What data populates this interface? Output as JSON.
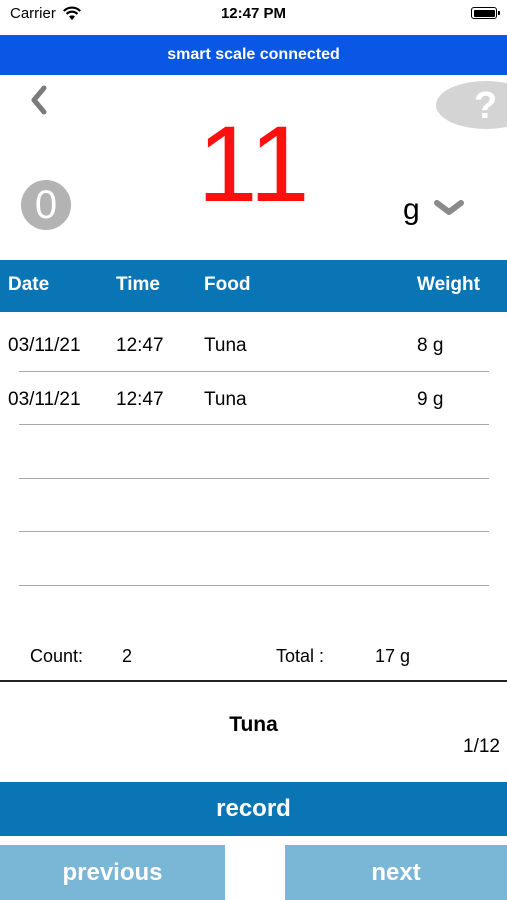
{
  "status_bar": {
    "carrier": "Carrier",
    "time": "12:47 PM"
  },
  "banner": {
    "text": "smart scale connected"
  },
  "scale": {
    "reading": "11",
    "zero_label": "0",
    "unit": "g",
    "reading_color": "#ff1010"
  },
  "icons": {
    "back": "chevron-left-icon",
    "help": "question-mark-icon",
    "unit_dropdown": "chevron-down-icon",
    "wifi": "wifi-icon",
    "battery": "battery-icon"
  },
  "table": {
    "columns": [
      "Date",
      "Time",
      "Food",
      "Weight"
    ],
    "rows": [
      {
        "date": "03/11/21",
        "time": "12:47",
        "food": "Tuna",
        "weight": "8 g"
      },
      {
        "date": "03/11/21",
        "time": "12:47",
        "food": "Tuna",
        "weight": "9 g"
      }
    ]
  },
  "summary": {
    "count_label": "Count:",
    "count_value": "2",
    "total_label": "Total :",
    "total_value": "17 g"
  },
  "current_food": {
    "name": "Tuna",
    "page": "1/12"
  },
  "actions": {
    "record": "record",
    "previous": "previous",
    "next": "next"
  },
  "colors": {
    "banner": "#0a57e6",
    "table_header": "#0a75b5",
    "record_button": "#0a75b5",
    "nav_buttons": "#7ab6d6"
  }
}
